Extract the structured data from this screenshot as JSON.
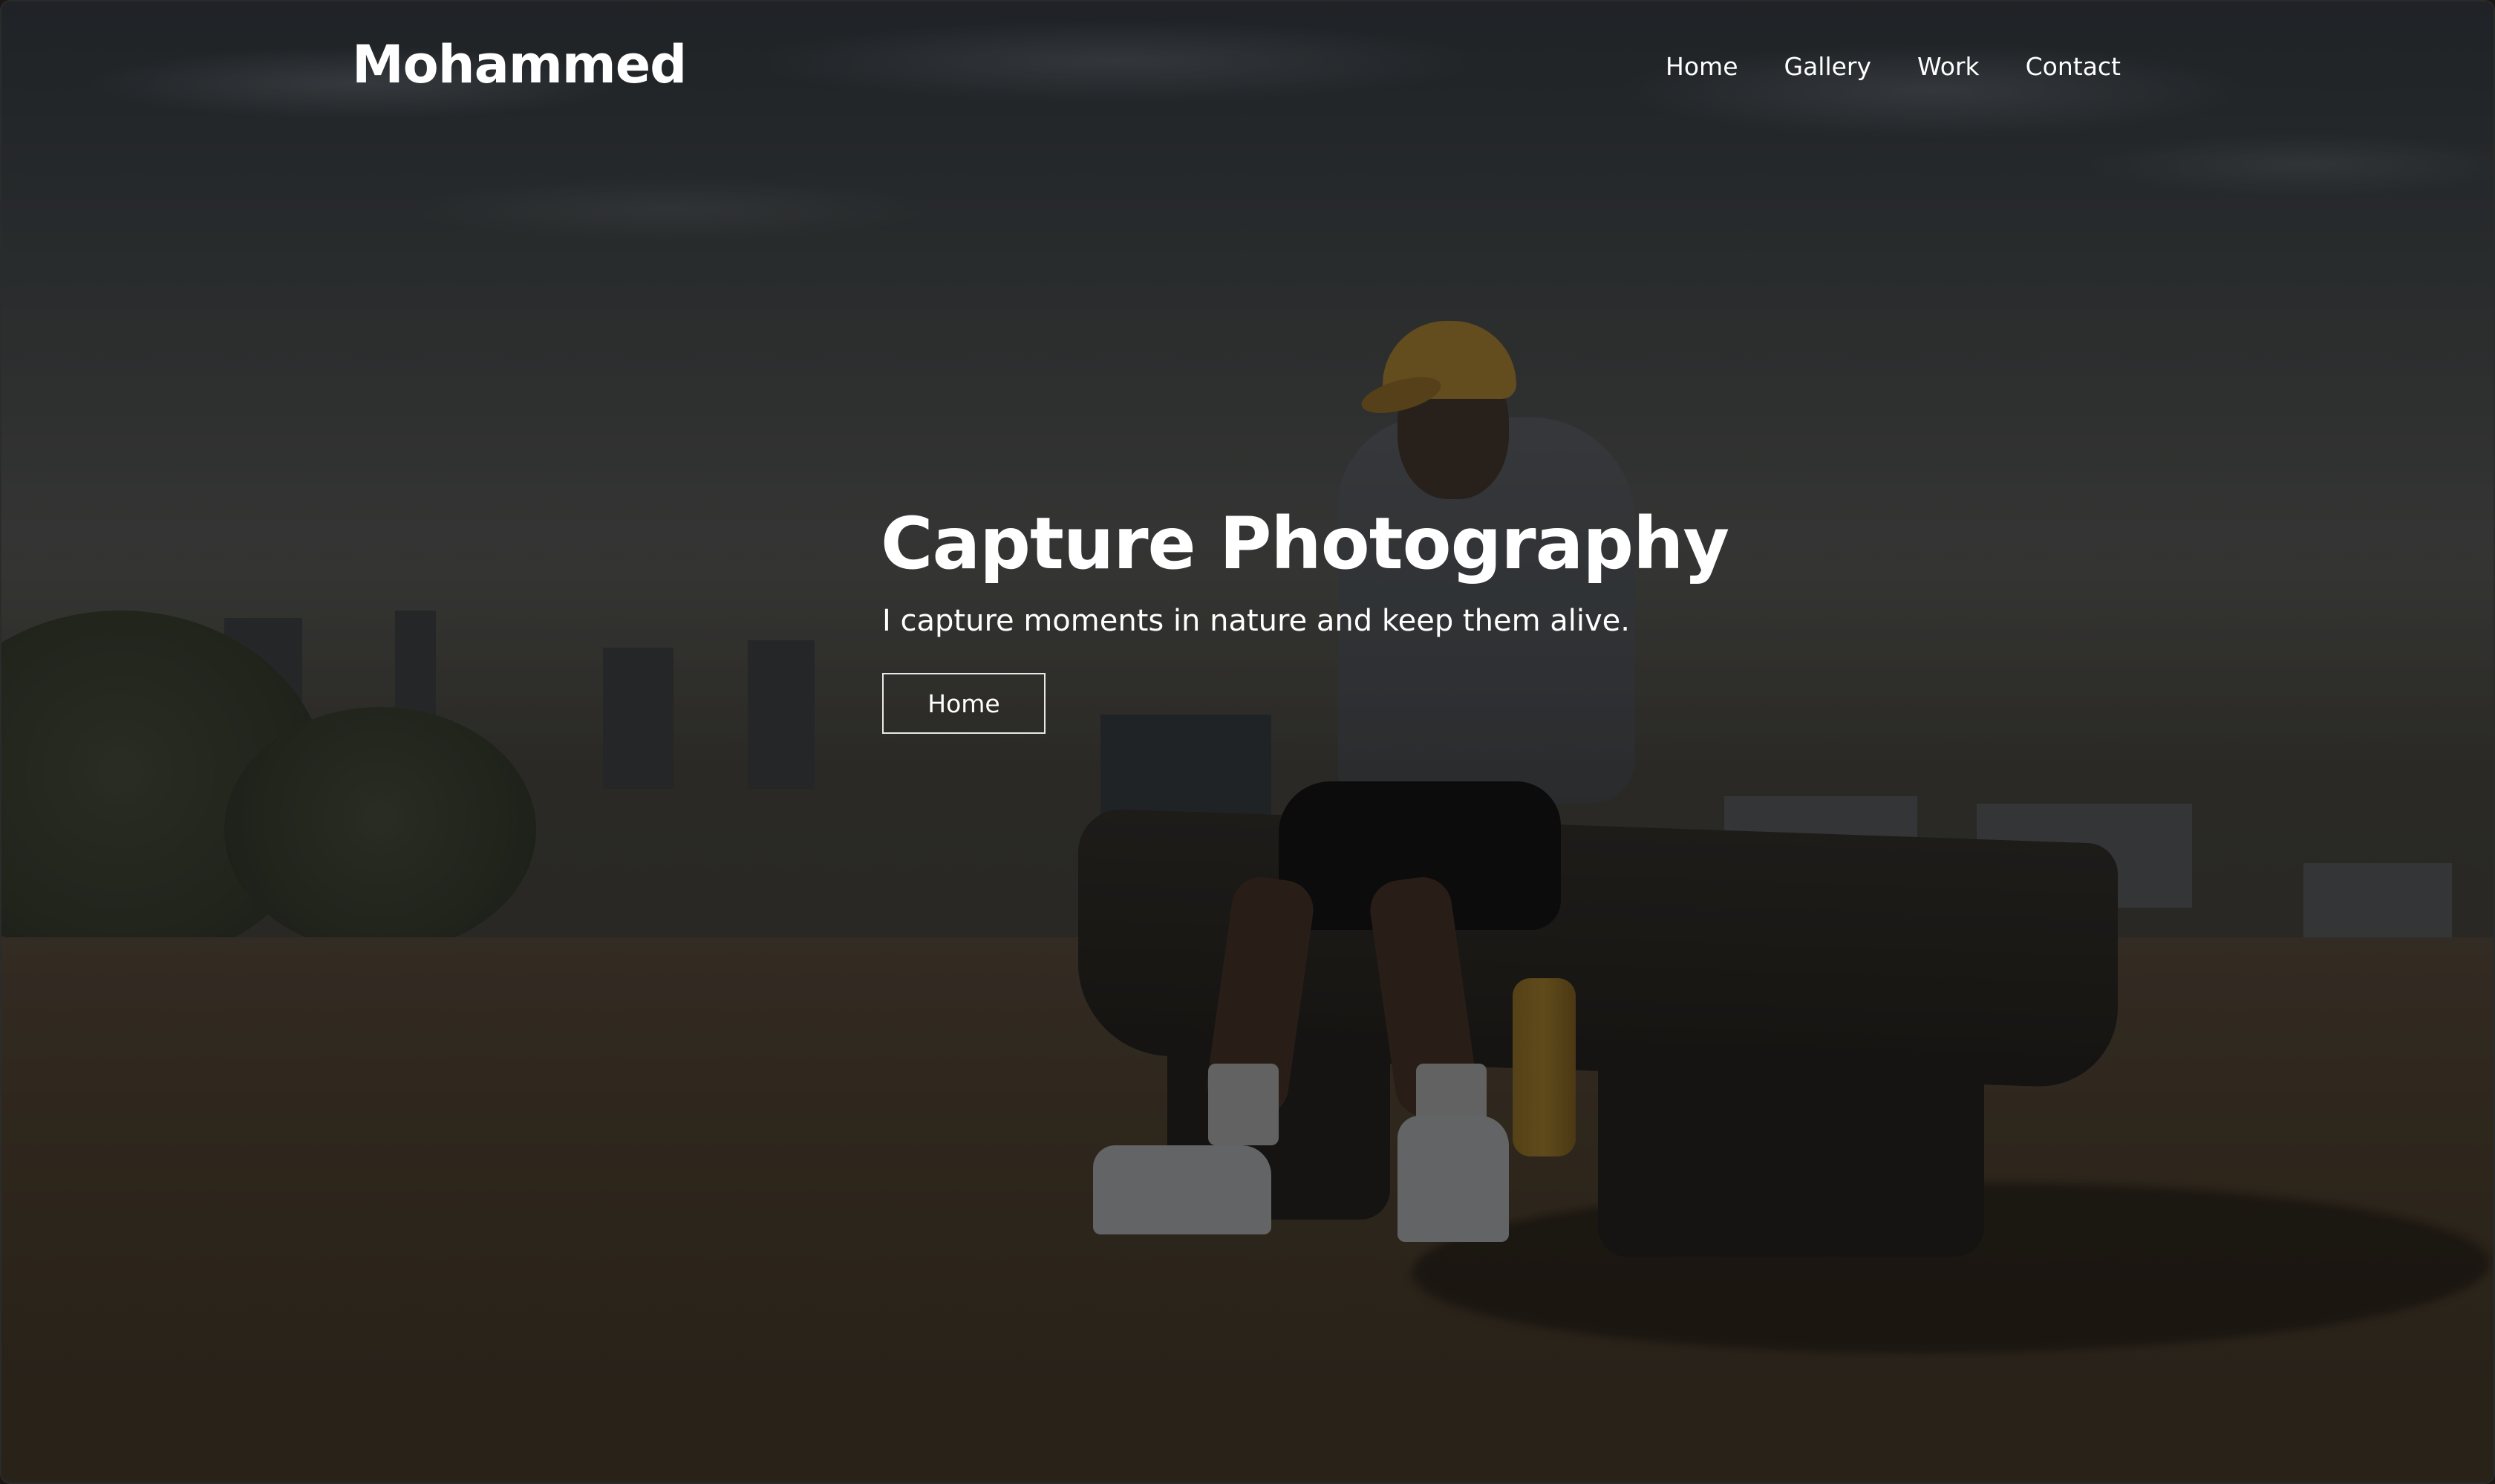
{
  "header": {
    "logo_text": "Mohammed",
    "nav": [
      {
        "label": "Home"
      },
      {
        "label": "Gallery"
      },
      {
        "label": "Work"
      },
      {
        "label": "Contact"
      }
    ]
  },
  "hero": {
    "title": "Capture Photography",
    "subtitle": "I capture moments in nature and keep them alive.",
    "button_label": "Home",
    "background_description_icon": "hero-photo"
  },
  "colors": {
    "text": "#ffffff",
    "button_border": "#e8e8e8",
    "overlay": "rgba(0,0,0,0.30)"
  }
}
